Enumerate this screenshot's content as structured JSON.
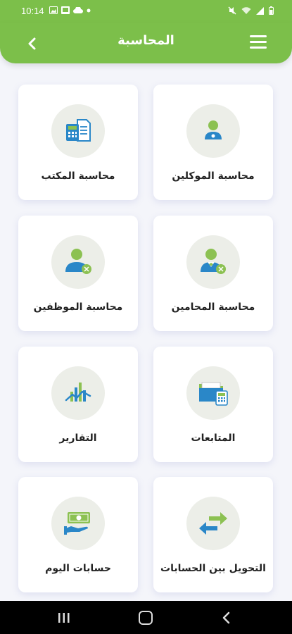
{
  "status": {
    "time": "10:14"
  },
  "header": {
    "title": "المحاسبة"
  },
  "cards": [
    {
      "label": "محاسبة الموكلين",
      "icon": "client-icon"
    },
    {
      "label": "محاسبة المكتب",
      "icon": "office-accounting-icon"
    },
    {
      "label": "محاسبة المحامين",
      "icon": "lawyer-icon"
    },
    {
      "label": "محاسبة الموظفين",
      "icon": "employee-icon"
    },
    {
      "label": "المتابعات",
      "icon": "folder-calculator-icon"
    },
    {
      "label": "التقارير",
      "icon": "report-chart-icon"
    },
    {
      "label": "التحويل بين الحسابات",
      "icon": "transfer-arrows-icon"
    },
    {
      "label": "حسابات اليوم",
      "icon": "cash-hand-icon"
    }
  ],
  "colors": {
    "brand_green": "#7cbf4a",
    "icon_blue": "#2a87c8",
    "icon_green": "#8cc152"
  }
}
